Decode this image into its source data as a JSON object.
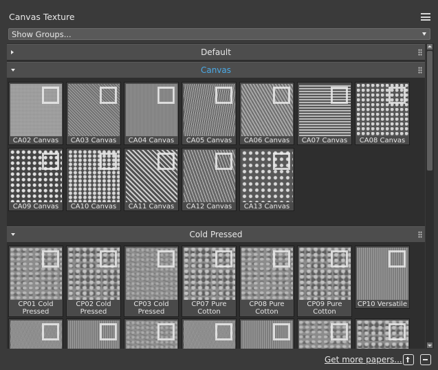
{
  "panel": {
    "title": "Canvas Texture"
  },
  "groups_dropdown": {
    "value": "Show Groups..."
  },
  "sections": [
    {
      "label": "Default",
      "expanded": false
    },
    {
      "label": "Canvas",
      "expanded": true,
      "active": true
    },
    {
      "label": "Cold Pressed",
      "expanded": true
    }
  ],
  "canvas_tiles": [
    "CA02 Canvas",
    "CA03 Canvas",
    "CA04 Canvas",
    "CA05 Canvas",
    "CA06 Canvas",
    "CA07 Canvas",
    "CA08 Canvas",
    "CA09 Canvas",
    "CA10 Canvas",
    "CA11 Canvas",
    "CA12 Canvas",
    "CA13 Canvas"
  ],
  "cold_pressed_tiles": [
    "CP01 Cold Pressed",
    "CP02 Cold Pressed",
    "CP03 Cold Pressed",
    "CP07 Pure Cotton",
    "CP08 Pure Cotton",
    "CP09 Pure Cotton",
    "CP10 Versatile"
  ],
  "footer": {
    "link": "Get more papers..."
  },
  "colors": {
    "accent": "#4aa9e6",
    "panel_bg": "#3a3a3a",
    "section_bar": "#4d4d4d"
  },
  "icons": {
    "menu": "hamburger-menu-icon",
    "collapse": "triangle-right-icon",
    "expand": "triangle-down-icon",
    "grip": "drag-grip-icon",
    "import": "import-paper-icon",
    "remove": "remove-paper-icon"
  }
}
